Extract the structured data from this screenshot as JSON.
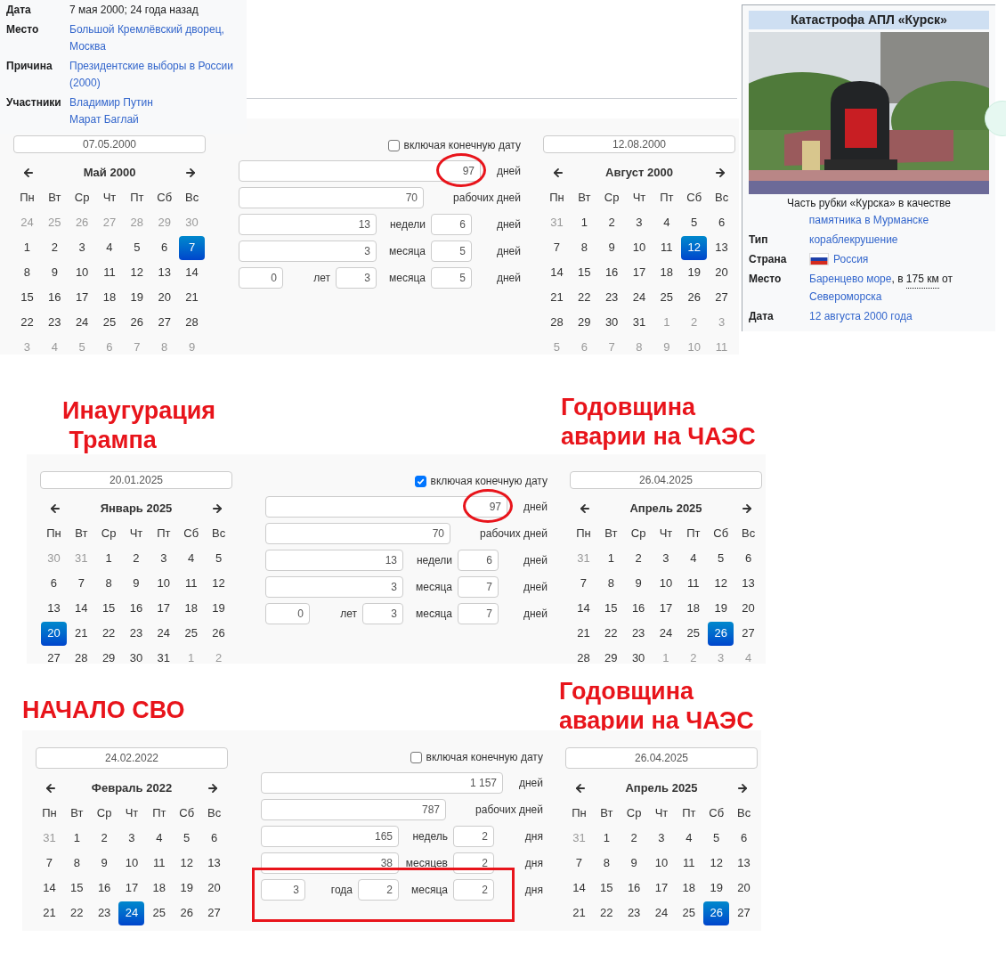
{
  "event_infobox": {
    "rows": [
      {
        "label": "Дата",
        "lines": [
          [
            {
              "text": "7 мая 2000; 24 года назад",
              "kind": "plain"
            }
          ]
        ]
      },
      {
        "label": "Место",
        "lines": [
          [
            {
              "text": "Большой Кремлёвский дворец,",
              "kind": "link"
            }
          ],
          [
            {
              "text": "Москва",
              "kind": "link"
            }
          ]
        ]
      },
      {
        "label": "Причина",
        "lines": [
          [
            {
              "text": "Президентские выборы в России",
              "kind": "link"
            }
          ],
          [
            {
              "text": "(2000)",
              "kind": "link"
            }
          ]
        ]
      },
      {
        "label": "Участники",
        "lines": [
          [
            {
              "text": "Владимир Путин",
              "kind": "link"
            }
          ],
          [
            {
              "text": "Марат Баглай",
              "kind": "link"
            }
          ]
        ]
      }
    ]
  },
  "kursk_infobox": {
    "title": "Катастрофа АПЛ «Курск»",
    "caption": [
      {
        "text": "Часть рубки «Курска» в качестве ",
        "kind": "plain"
      },
      {
        "text": "памятника в Мурманске",
        "kind": "link"
      }
    ],
    "rows": [
      {
        "label": "Тип",
        "flag": false,
        "lines": [
          [
            {
              "text": "кораблекрушение",
              "kind": "link"
            }
          ]
        ]
      },
      {
        "label": "Страна",
        "flag": true,
        "lines": [
          [
            {
              "text": "Россия",
              "kind": "link"
            }
          ]
        ]
      },
      {
        "label": "Место",
        "flag": false,
        "lines": [
          [
            {
              "text": "Баренцево море",
              "kind": "link"
            },
            {
              "text": ", в ",
              "kind": "plain"
            },
            {
              "text": "175 км",
              "kind": "abbr"
            },
            {
              "text": " от",
              "kind": "plain"
            }
          ],
          [
            {
              "text": "Североморска",
              "kind": "link"
            }
          ]
        ]
      },
      {
        "label": "Дата",
        "flag": false,
        "lines": [
          [
            {
              "text": "12 августа 2000 года",
              "kind": "link"
            }
          ]
        ]
      }
    ]
  },
  "annotations": [
    {
      "lines": [
        "Инаугурация",
        " Трампа"
      ]
    },
    {
      "lines": [
        "Годовщина",
        "аварии на ЧАЭС"
      ]
    },
    {
      "lines": [
        "НАЧАЛО СВО"
      ]
    },
    {
      "lines": [
        "Годовщина",
        "аварии на ЧАЭС"
      ]
    }
  ],
  "calculators": [
    {
      "start_date": "07.05.2000",
      "start_calendar": {
        "title": "Май 2000",
        "weekdays": [
          "Пн",
          "Вт",
          "Ср",
          "Чт",
          "Пт",
          "Сб",
          "Вс"
        ],
        "weeks": [
          [
            {
              "day": "24",
              "other_month": true,
              "selected": false
            },
            {
              "day": "25",
              "other_month": true,
              "selected": false
            },
            {
              "day": "26",
              "other_month": true,
              "selected": false
            },
            {
              "day": "27",
              "other_month": true,
              "selected": false
            },
            {
              "day": "28",
              "other_month": true,
              "selected": false
            },
            {
              "day": "29",
              "other_month": true,
              "selected": false
            },
            {
              "day": "30",
              "other_month": true,
              "selected": false
            }
          ],
          [
            {
              "day": "1",
              "other_month": false,
              "selected": false
            },
            {
              "day": "2",
              "other_month": false,
              "selected": false
            },
            {
              "day": "3",
              "other_month": false,
              "selected": false
            },
            {
              "day": "4",
              "other_month": false,
              "selected": false
            },
            {
              "day": "5",
              "other_month": false,
              "selected": false
            },
            {
              "day": "6",
              "other_month": false,
              "selected": false
            },
            {
              "day": "7",
              "other_month": false,
              "selected": true
            }
          ],
          [
            {
              "day": "8",
              "other_month": false,
              "selected": false
            },
            {
              "day": "9",
              "other_month": false,
              "selected": false
            },
            {
              "day": "10",
              "other_month": false,
              "selected": false
            },
            {
              "day": "11",
              "other_month": false,
              "selected": false
            },
            {
              "day": "12",
              "other_month": false,
              "selected": false
            },
            {
              "day": "13",
              "other_month": false,
              "selected": false
            },
            {
              "day": "14",
              "other_month": false,
              "selected": false
            }
          ],
          [
            {
              "day": "15",
              "other_month": false,
              "selected": false
            },
            {
              "day": "16",
              "other_month": false,
              "selected": false
            },
            {
              "day": "17",
              "other_month": false,
              "selected": false
            },
            {
              "day": "18",
              "other_month": false,
              "selected": false
            },
            {
              "day": "19",
              "other_month": false,
              "selected": false
            },
            {
              "day": "20",
              "other_month": false,
              "selected": false
            },
            {
              "day": "21",
              "other_month": false,
              "selected": false
            }
          ],
          [
            {
              "day": "22",
              "other_month": false,
              "selected": false
            },
            {
              "day": "23",
              "other_month": false,
              "selected": false
            },
            {
              "day": "24",
              "other_month": false,
              "selected": false
            },
            {
              "day": "25",
              "other_month": false,
              "selected": false
            },
            {
              "day": "26",
              "other_month": false,
              "selected": false
            },
            {
              "day": "27",
              "other_month": false,
              "selected": false
            },
            {
              "day": "28",
              "other_month": false,
              "selected": false
            }
          ],
          [
            {
              "day": "3",
              "other_month": true,
              "selected": false
            },
            {
              "day": "4",
              "other_month": true,
              "selected": false
            },
            {
              "day": "5",
              "other_month": true,
              "selected": false
            },
            {
              "day": "6",
              "other_month": true,
              "selected": false
            },
            {
              "day": "7",
              "other_month": true,
              "selected": false
            },
            {
              "day": "8",
              "other_month": true,
              "selected": false
            },
            {
              "day": "9",
              "other_month": true,
              "selected": false
            }
          ]
        ]
      },
      "include_end_date": {
        "label": "включая конечную дату",
        "checked": false
      },
      "results": [
        {
          "kind": "total",
          "boxed": false,
          "cells": [
            {
              "value": "97",
              "circled": true
            }
          ],
          "labels": [
            "дней"
          ]
        },
        {
          "kind": "workdays",
          "boxed": false,
          "cells": [
            {
              "value": "70"
            }
          ],
          "labels": [
            "рабочих дней"
          ]
        },
        {
          "kind": "split",
          "boxed": false,
          "cells": [
            {
              "value": "13"
            },
            {
              "value": "6"
            }
          ],
          "labels": [
            "недели",
            "дней"
          ]
        },
        {
          "kind": "split",
          "boxed": false,
          "cells": [
            {
              "value": "3"
            },
            {
              "value": "5"
            }
          ],
          "labels": [
            "месяца",
            "дней"
          ]
        },
        {
          "kind": "ymd",
          "boxed": false,
          "cells": [
            {
              "value": "0"
            },
            {
              "value": "3"
            },
            {
              "value": "5"
            }
          ],
          "labels": [
            "лет",
            "месяца",
            "дней"
          ]
        }
      ],
      "end_date": "12.08.2000",
      "end_calendar": {
        "title": "Август 2000",
        "weekdays": [
          "Пн",
          "Вт",
          "Ср",
          "Чт",
          "Пт",
          "Сб",
          "Вс"
        ],
        "weeks": [
          [
            {
              "day": "31",
              "other_month": true,
              "selected": false
            },
            {
              "day": "1",
              "other_month": false,
              "selected": false
            },
            {
              "day": "2",
              "other_month": false,
              "selected": false
            },
            {
              "day": "3",
              "other_month": false,
              "selected": false
            },
            {
              "day": "4",
              "other_month": false,
              "selected": false
            },
            {
              "day": "5",
              "other_month": false,
              "selected": false
            },
            {
              "day": "6",
              "other_month": false,
              "selected": false
            }
          ],
          [
            {
              "day": "7",
              "other_month": false,
              "selected": false
            },
            {
              "day": "8",
              "other_month": false,
              "selected": false
            },
            {
              "day": "9",
              "other_month": false,
              "selected": false
            },
            {
              "day": "10",
              "other_month": false,
              "selected": false
            },
            {
              "day": "11",
              "other_month": false,
              "selected": false
            },
            {
              "day": "12",
              "other_month": false,
              "selected": true
            },
            {
              "day": "13",
              "other_month": false,
              "selected": false
            }
          ],
          [
            {
              "day": "14",
              "other_month": false,
              "selected": false
            },
            {
              "day": "15",
              "other_month": false,
              "selected": false
            },
            {
              "day": "16",
              "other_month": false,
              "selected": false
            },
            {
              "day": "17",
              "other_month": false,
              "selected": false
            },
            {
              "day": "18",
              "other_month": false,
              "selected": false
            },
            {
              "day": "19",
              "other_month": false,
              "selected": false
            },
            {
              "day": "20",
              "other_month": false,
              "selected": false
            }
          ],
          [
            {
              "day": "21",
              "other_month": false,
              "selected": false
            },
            {
              "day": "22",
              "other_month": false,
              "selected": false
            },
            {
              "day": "23",
              "other_month": false,
              "selected": false
            },
            {
              "day": "24",
              "other_month": false,
              "selected": false
            },
            {
              "day": "25",
              "other_month": false,
              "selected": false
            },
            {
              "day": "26",
              "other_month": false,
              "selected": false
            },
            {
              "day": "27",
              "other_month": false,
              "selected": false
            }
          ],
          [
            {
              "day": "28",
              "other_month": false,
              "selected": false
            },
            {
              "day": "29",
              "other_month": false,
              "selected": false
            },
            {
              "day": "30",
              "other_month": false,
              "selected": false
            },
            {
              "day": "31",
              "other_month": false,
              "selected": false
            },
            {
              "day": "1",
              "other_month": true,
              "selected": false
            },
            {
              "day": "2",
              "other_month": true,
              "selected": false
            },
            {
              "day": "3",
              "other_month": true,
              "selected": false
            }
          ],
          [
            {
              "day": "5",
              "other_month": true,
              "selected": false
            },
            {
              "day": "6",
              "other_month": true,
              "selected": false
            },
            {
              "day": "7",
              "other_month": true,
              "selected": false
            },
            {
              "day": "8",
              "other_month": true,
              "selected": false
            },
            {
              "day": "9",
              "other_month": true,
              "selected": false
            },
            {
              "day": "10",
              "other_month": true,
              "selected": false
            },
            {
              "day": "11",
              "other_month": true,
              "selected": false
            }
          ]
        ]
      }
    },
    {
      "start_date": "20.01.2025",
      "start_calendar": {
        "title": "Январь 2025",
        "weekdays": [
          "Пн",
          "Вт",
          "Ср",
          "Чт",
          "Пт",
          "Сб",
          "Вс"
        ],
        "weeks": [
          [
            {
              "day": "30",
              "other_month": true,
              "selected": false
            },
            {
              "day": "31",
              "other_month": true,
              "selected": false
            },
            {
              "day": "1",
              "other_month": false,
              "selected": false
            },
            {
              "day": "2",
              "other_month": false,
              "selected": false
            },
            {
              "day": "3",
              "other_month": false,
              "selected": false
            },
            {
              "day": "4",
              "other_month": false,
              "selected": false
            },
            {
              "day": "5",
              "other_month": false,
              "selected": false
            }
          ],
          [
            {
              "day": "6",
              "other_month": false,
              "selected": false
            },
            {
              "day": "7",
              "other_month": false,
              "selected": false
            },
            {
              "day": "8",
              "other_month": false,
              "selected": false
            },
            {
              "day": "9",
              "other_month": false,
              "selected": false
            },
            {
              "day": "10",
              "other_month": false,
              "selected": false
            },
            {
              "day": "11",
              "other_month": false,
              "selected": false
            },
            {
              "day": "12",
              "other_month": false,
              "selected": false
            }
          ],
          [
            {
              "day": "13",
              "other_month": false,
              "selected": false
            },
            {
              "day": "14",
              "other_month": false,
              "selected": false
            },
            {
              "day": "15",
              "other_month": false,
              "selected": false
            },
            {
              "day": "16",
              "other_month": false,
              "selected": false
            },
            {
              "day": "17",
              "other_month": false,
              "selected": false
            },
            {
              "day": "18",
              "other_month": false,
              "selected": false
            },
            {
              "day": "19",
              "other_month": false,
              "selected": false
            }
          ],
          [
            {
              "day": "20",
              "other_month": false,
              "selected": true
            },
            {
              "day": "21",
              "other_month": false,
              "selected": false
            },
            {
              "day": "22",
              "other_month": false,
              "selected": false
            },
            {
              "day": "23",
              "other_month": false,
              "selected": false
            },
            {
              "day": "24",
              "other_month": false,
              "selected": false
            },
            {
              "day": "25",
              "other_month": false,
              "selected": false
            },
            {
              "day": "26",
              "other_month": false,
              "selected": false
            }
          ],
          [
            {
              "day": "27",
              "other_month": false,
              "selected": false
            },
            {
              "day": "28",
              "other_month": false,
              "selected": false
            },
            {
              "day": "29",
              "other_month": false,
              "selected": false
            },
            {
              "day": "30",
              "other_month": false,
              "selected": false
            },
            {
              "day": "31",
              "other_month": false,
              "selected": false
            },
            {
              "day": "1",
              "other_month": true,
              "selected": false
            },
            {
              "day": "2",
              "other_month": true,
              "selected": false
            }
          ]
        ]
      },
      "include_end_date": {
        "label": "включая конечную дату",
        "checked": true
      },
      "results": [
        {
          "kind": "total",
          "boxed": false,
          "cells": [
            {
              "value": "97",
              "circled": true
            }
          ],
          "labels": [
            "дней"
          ]
        },
        {
          "kind": "workdays",
          "boxed": false,
          "cells": [
            {
              "value": "70"
            }
          ],
          "labels": [
            "рабочих дней"
          ]
        },
        {
          "kind": "split",
          "boxed": false,
          "cells": [
            {
              "value": "13"
            },
            {
              "value": "6"
            }
          ],
          "labels": [
            "недели",
            "дней"
          ]
        },
        {
          "kind": "split",
          "boxed": false,
          "cells": [
            {
              "value": "3"
            },
            {
              "value": "7"
            }
          ],
          "labels": [
            "месяца",
            "дней"
          ]
        },
        {
          "kind": "ymd",
          "boxed": false,
          "cells": [
            {
              "value": "0"
            },
            {
              "value": "3"
            },
            {
              "value": "7"
            }
          ],
          "labels": [
            "лет",
            "месяца",
            "дней"
          ]
        }
      ],
      "end_date": "26.04.2025",
      "end_calendar": {
        "title": "Апрель 2025",
        "weekdays": [
          "Пн",
          "Вт",
          "Ср",
          "Чт",
          "Пт",
          "Сб",
          "Вс"
        ],
        "weeks": [
          [
            {
              "day": "31",
              "other_month": true,
              "selected": false
            },
            {
              "day": "1",
              "other_month": false,
              "selected": false
            },
            {
              "day": "2",
              "other_month": false,
              "selected": false
            },
            {
              "day": "3",
              "other_month": false,
              "selected": false
            },
            {
              "day": "4",
              "other_month": false,
              "selected": false
            },
            {
              "day": "5",
              "other_month": false,
              "selected": false
            },
            {
              "day": "6",
              "other_month": false,
              "selected": false
            }
          ],
          [
            {
              "day": "7",
              "other_month": false,
              "selected": false
            },
            {
              "day": "8",
              "other_month": false,
              "selected": false
            },
            {
              "day": "9",
              "other_month": false,
              "selected": false
            },
            {
              "day": "10",
              "other_month": false,
              "selected": false
            },
            {
              "day": "11",
              "other_month": false,
              "selected": false
            },
            {
              "day": "12",
              "other_month": false,
              "selected": false
            },
            {
              "day": "13",
              "other_month": false,
              "selected": false
            }
          ],
          [
            {
              "day": "14",
              "other_month": false,
              "selected": false
            },
            {
              "day": "15",
              "other_month": false,
              "selected": false
            },
            {
              "day": "16",
              "other_month": false,
              "selected": false
            },
            {
              "day": "17",
              "other_month": false,
              "selected": false
            },
            {
              "day": "18",
              "other_month": false,
              "selected": false
            },
            {
              "day": "19",
              "other_month": false,
              "selected": false
            },
            {
              "day": "20",
              "other_month": false,
              "selected": false
            }
          ],
          [
            {
              "day": "21",
              "other_month": false,
              "selected": false
            },
            {
              "day": "22",
              "other_month": false,
              "selected": false
            },
            {
              "day": "23",
              "other_month": false,
              "selected": false
            },
            {
              "day": "24",
              "other_month": false,
              "selected": false
            },
            {
              "day": "25",
              "other_month": false,
              "selected": false
            },
            {
              "day": "26",
              "other_month": false,
              "selected": true
            },
            {
              "day": "27",
              "other_month": false,
              "selected": false
            }
          ],
          [
            {
              "day": "28",
              "other_month": false,
              "selected": false
            },
            {
              "day": "29",
              "other_month": false,
              "selected": false
            },
            {
              "day": "30",
              "other_month": false,
              "selected": false
            },
            {
              "day": "1",
              "other_month": true,
              "selected": false
            },
            {
              "day": "2",
              "other_month": true,
              "selected": false
            },
            {
              "day": "3",
              "other_month": true,
              "selected": false
            },
            {
              "day": "4",
              "other_month": true,
              "selected": false
            }
          ]
        ]
      }
    },
    {
      "start_date": "24.02.2022",
      "start_calendar": {
        "title": "Февраль 2022",
        "weekdays": [
          "Пн",
          "Вт",
          "Ср",
          "Чт",
          "Пт",
          "Сб",
          "Вс"
        ],
        "weeks": [
          [
            {
              "day": "31",
              "other_month": true,
              "selected": false
            },
            {
              "day": "1",
              "other_month": false,
              "selected": false
            },
            {
              "day": "2",
              "other_month": false,
              "selected": false
            },
            {
              "day": "3",
              "other_month": false,
              "selected": false
            },
            {
              "day": "4",
              "other_month": false,
              "selected": false
            },
            {
              "day": "5",
              "other_month": false,
              "selected": false
            },
            {
              "day": "6",
              "other_month": false,
              "selected": false
            }
          ],
          [
            {
              "day": "7",
              "other_month": false,
              "selected": false
            },
            {
              "day": "8",
              "other_month": false,
              "selected": false
            },
            {
              "day": "9",
              "other_month": false,
              "selected": false
            },
            {
              "day": "10",
              "other_month": false,
              "selected": false
            },
            {
              "day": "11",
              "other_month": false,
              "selected": false
            },
            {
              "day": "12",
              "other_month": false,
              "selected": false
            },
            {
              "day": "13",
              "other_month": false,
              "selected": false
            }
          ],
          [
            {
              "day": "14",
              "other_month": false,
              "selected": false
            },
            {
              "day": "15",
              "other_month": false,
              "selected": false
            },
            {
              "day": "16",
              "other_month": false,
              "selected": false
            },
            {
              "day": "17",
              "other_month": false,
              "selected": false
            },
            {
              "day": "18",
              "other_month": false,
              "selected": false
            },
            {
              "day": "19",
              "other_month": false,
              "selected": false
            },
            {
              "day": "20",
              "other_month": false,
              "selected": false
            }
          ],
          [
            {
              "day": "21",
              "other_month": false,
              "selected": false
            },
            {
              "day": "22",
              "other_month": false,
              "selected": false
            },
            {
              "day": "23",
              "other_month": false,
              "selected": false
            },
            {
              "day": "24",
              "other_month": false,
              "selected": true
            },
            {
              "day": "25",
              "other_month": false,
              "selected": false
            },
            {
              "day": "26",
              "other_month": false,
              "selected": false
            },
            {
              "day": "27",
              "other_month": false,
              "selected": false
            }
          ]
        ]
      },
      "include_end_date": {
        "label": "включая конечную дату",
        "checked": false
      },
      "results": [
        {
          "kind": "total",
          "boxed": false,
          "cells": [
            {
              "value": "1 157",
              "circled": false
            }
          ],
          "labels": [
            "дней"
          ]
        },
        {
          "kind": "workdays",
          "boxed": false,
          "cells": [
            {
              "value": "787"
            }
          ],
          "labels": [
            "рабочих дней"
          ]
        },
        {
          "kind": "split",
          "boxed": false,
          "cells": [
            {
              "value": "165"
            },
            {
              "value": "2"
            }
          ],
          "labels": [
            "недель",
            "дня"
          ]
        },
        {
          "kind": "split",
          "boxed": false,
          "cells": [
            {
              "value": "38"
            },
            {
              "value": "2"
            }
          ],
          "labels": [
            "месяцев",
            "дня"
          ]
        },
        {
          "kind": "ymd",
          "boxed": true,
          "cells": [
            {
              "value": "3"
            },
            {
              "value": "2"
            },
            {
              "value": "2"
            }
          ],
          "labels": [
            "года",
            "месяца",
            "дня"
          ]
        }
      ],
      "end_date": "26.04.2025",
      "end_calendar": {
        "title": "Апрель 2025",
        "weekdays": [
          "Пн",
          "Вт",
          "Ср",
          "Чт",
          "Пт",
          "Сб",
          "Вс"
        ],
        "weeks": [
          [
            {
              "day": "31",
              "other_month": true,
              "selected": false
            },
            {
              "day": "1",
              "other_month": false,
              "selected": false
            },
            {
              "day": "2",
              "other_month": false,
              "selected": false
            },
            {
              "day": "3",
              "other_month": false,
              "selected": false
            },
            {
              "day": "4",
              "other_month": false,
              "selected": false
            },
            {
              "day": "5",
              "other_month": false,
              "selected": false
            },
            {
              "day": "6",
              "other_month": false,
              "selected": false
            }
          ],
          [
            {
              "day": "7",
              "other_month": false,
              "selected": false
            },
            {
              "day": "8",
              "other_month": false,
              "selected": false
            },
            {
              "day": "9",
              "other_month": false,
              "selected": false
            },
            {
              "day": "10",
              "other_month": false,
              "selected": false
            },
            {
              "day": "11",
              "other_month": false,
              "selected": false
            },
            {
              "day": "12",
              "other_month": false,
              "selected": false
            },
            {
              "day": "13",
              "other_month": false,
              "selected": false
            }
          ],
          [
            {
              "day": "14",
              "other_month": false,
              "selected": false
            },
            {
              "day": "15",
              "other_month": false,
              "selected": false
            },
            {
              "day": "16",
              "other_month": false,
              "selected": false
            },
            {
              "day": "17",
              "other_month": false,
              "selected": false
            },
            {
              "day": "18",
              "other_month": false,
              "selected": false
            },
            {
              "day": "19",
              "other_month": false,
              "selected": false
            },
            {
              "day": "20",
              "other_month": false,
              "selected": false
            }
          ],
          [
            {
              "day": "21",
              "other_month": false,
              "selected": false
            },
            {
              "day": "22",
              "other_month": false,
              "selected": false
            },
            {
              "day": "23",
              "other_month": false,
              "selected": false
            },
            {
              "day": "24",
              "other_month": false,
              "selected": false
            },
            {
              "day": "25",
              "other_month": false,
              "selected": false
            },
            {
              "day": "26",
              "other_month": false,
              "selected": true
            },
            {
              "day": "27",
              "other_month": false,
              "selected": false
            }
          ]
        ]
      }
    }
  ]
}
